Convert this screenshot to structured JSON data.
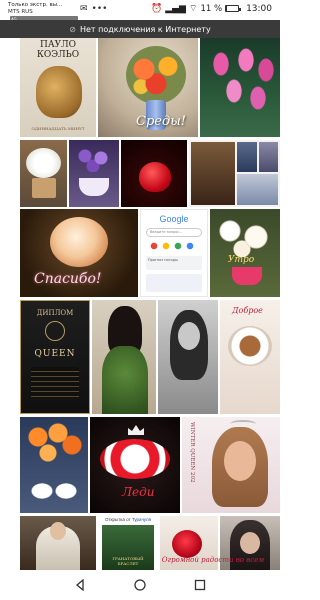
{
  "status_bar": {
    "notification_title": "Только экстр. вы...",
    "carrier": "MTS RUS",
    "network_badge": "4G",
    "battery_percent": "11 %",
    "battery_level": 0.11,
    "time": "13:00"
  },
  "banner": {
    "text": "Нет подключения к Интернету",
    "icon": "offline-icon"
  },
  "tiles": {
    "book1_author": "ПАУЛО КОЭЛЬО",
    "book1_subtitle": "ОДИННАДЦАТЬ МИНУТ",
    "wednesday_text": "Среды!",
    "thanks_text": "Спасибо!",
    "morning_text": "Утро",
    "diploma_title": "ДИПЛОМ",
    "queen_text": "QUEEN",
    "dobroe_text": "Доброе",
    "postcard_label": "Открытка от",
    "postcard_author": "Турачуля",
    "winter_queen": "WINTER QUEEN 202",
    "book2_title": "ГРАНАТОВЫЙ БРАСЛЕТ",
    "joy_text": "Огромной радости во всем"
  },
  "google_mock": {
    "logo": "Google",
    "search_placeholder": "Введите запрос...",
    "weather_label": "Прогноз погоды"
  },
  "colors": {
    "banner_bg": "#3a3a3a",
    "status_bg": "#ffffff"
  },
  "nav": {
    "back": "back-icon",
    "home": "home-icon",
    "recents": "recents-icon"
  }
}
